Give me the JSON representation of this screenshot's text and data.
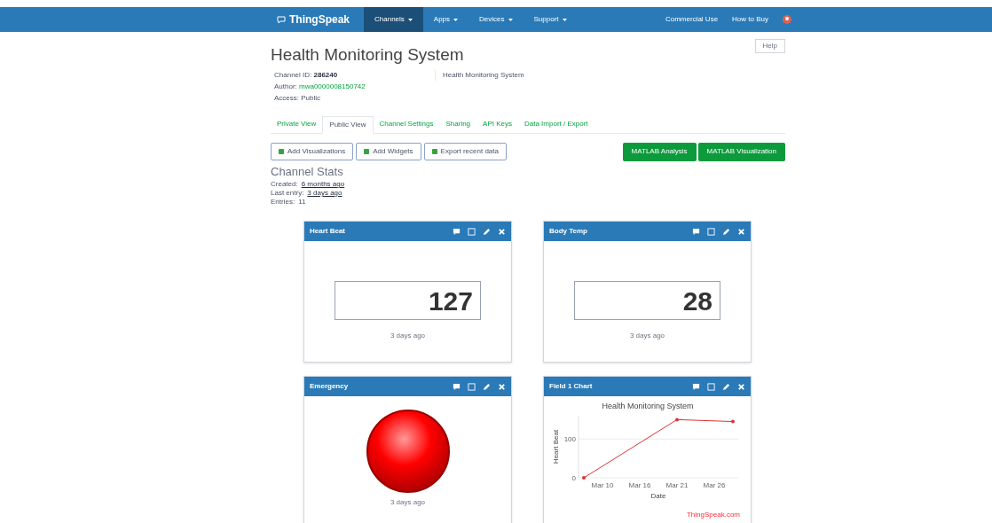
{
  "navbar": {
    "logo": "ThingSpeak",
    "menu": [
      {
        "label": "Channels",
        "selected": true
      },
      {
        "label": "Apps",
        "selected": false
      },
      {
        "label": "Devices",
        "selected": false
      },
      {
        "label": "Support",
        "selected": false
      }
    ],
    "right": [
      "Commercial Use",
      "How to Buy"
    ]
  },
  "channel": {
    "title": "Health Monitoring System",
    "help_button": "Help",
    "id_label": "Channel ID:",
    "id": "286240",
    "author_label": "Author:",
    "author": "mwa0000008150742",
    "access_label": "Access:",
    "access": "Public",
    "description": "Health Monitoring System"
  },
  "tabs": [
    {
      "label": "Private View",
      "selected": false
    },
    {
      "label": "Public View",
      "selected": true
    },
    {
      "label": "Channel Settings",
      "selected": false
    },
    {
      "label": "Sharing",
      "selected": false
    },
    {
      "label": "API Keys",
      "selected": false
    },
    {
      "label": "Data Import / Export",
      "selected": false
    }
  ],
  "actions": [
    "Add Visualizations",
    "Add Widgets",
    "Export recent data"
  ],
  "matlab_buttons": [
    "MATLAB Analysis",
    "MATLAB Visualization"
  ],
  "stats": {
    "title": "Channel Stats",
    "rows": [
      {
        "label": "Created:",
        "value": "6 months ago",
        "link": true
      },
      {
        "label": "Last entry:",
        "value": "3 days ago",
        "link": true
      },
      {
        "label": "Entries:",
        "value": "11",
        "link": false
      }
    ]
  },
  "widgets": [
    {
      "kind": "display",
      "title": "Heart Beat",
      "value": "127",
      "footer": "3 days ago"
    },
    {
      "kind": "display",
      "title": "Body Temp",
      "value": "28",
      "footer": "3 days ago"
    },
    {
      "kind": "lamp",
      "title": "Emergency",
      "on": true,
      "footer": "3 days ago"
    },
    {
      "kind": "chart",
      "title": "Field 1 Chart",
      "credit": "ThingSpeak.com",
      "chart_data": {
        "type": "line",
        "title": "Health Monitoring System",
        "xlabel": "Date",
        "ylabel": "Heart Beat",
        "categories": [
          null,
          "Mar 10",
          null,
          "Mar 16",
          null,
          "Mar 21",
          null,
          "Mar 26",
          null
        ],
        "series": [
          {
            "color": "#dd3333",
            "values": [
              0,
              null,
              null,
              null,
              null,
              150,
              null,
              null,
              145
            ]
          }
        ],
        "ylim": [
          0,
          160
        ],
        "yticks": [
          0,
          100
        ]
      }
    }
  ]
}
